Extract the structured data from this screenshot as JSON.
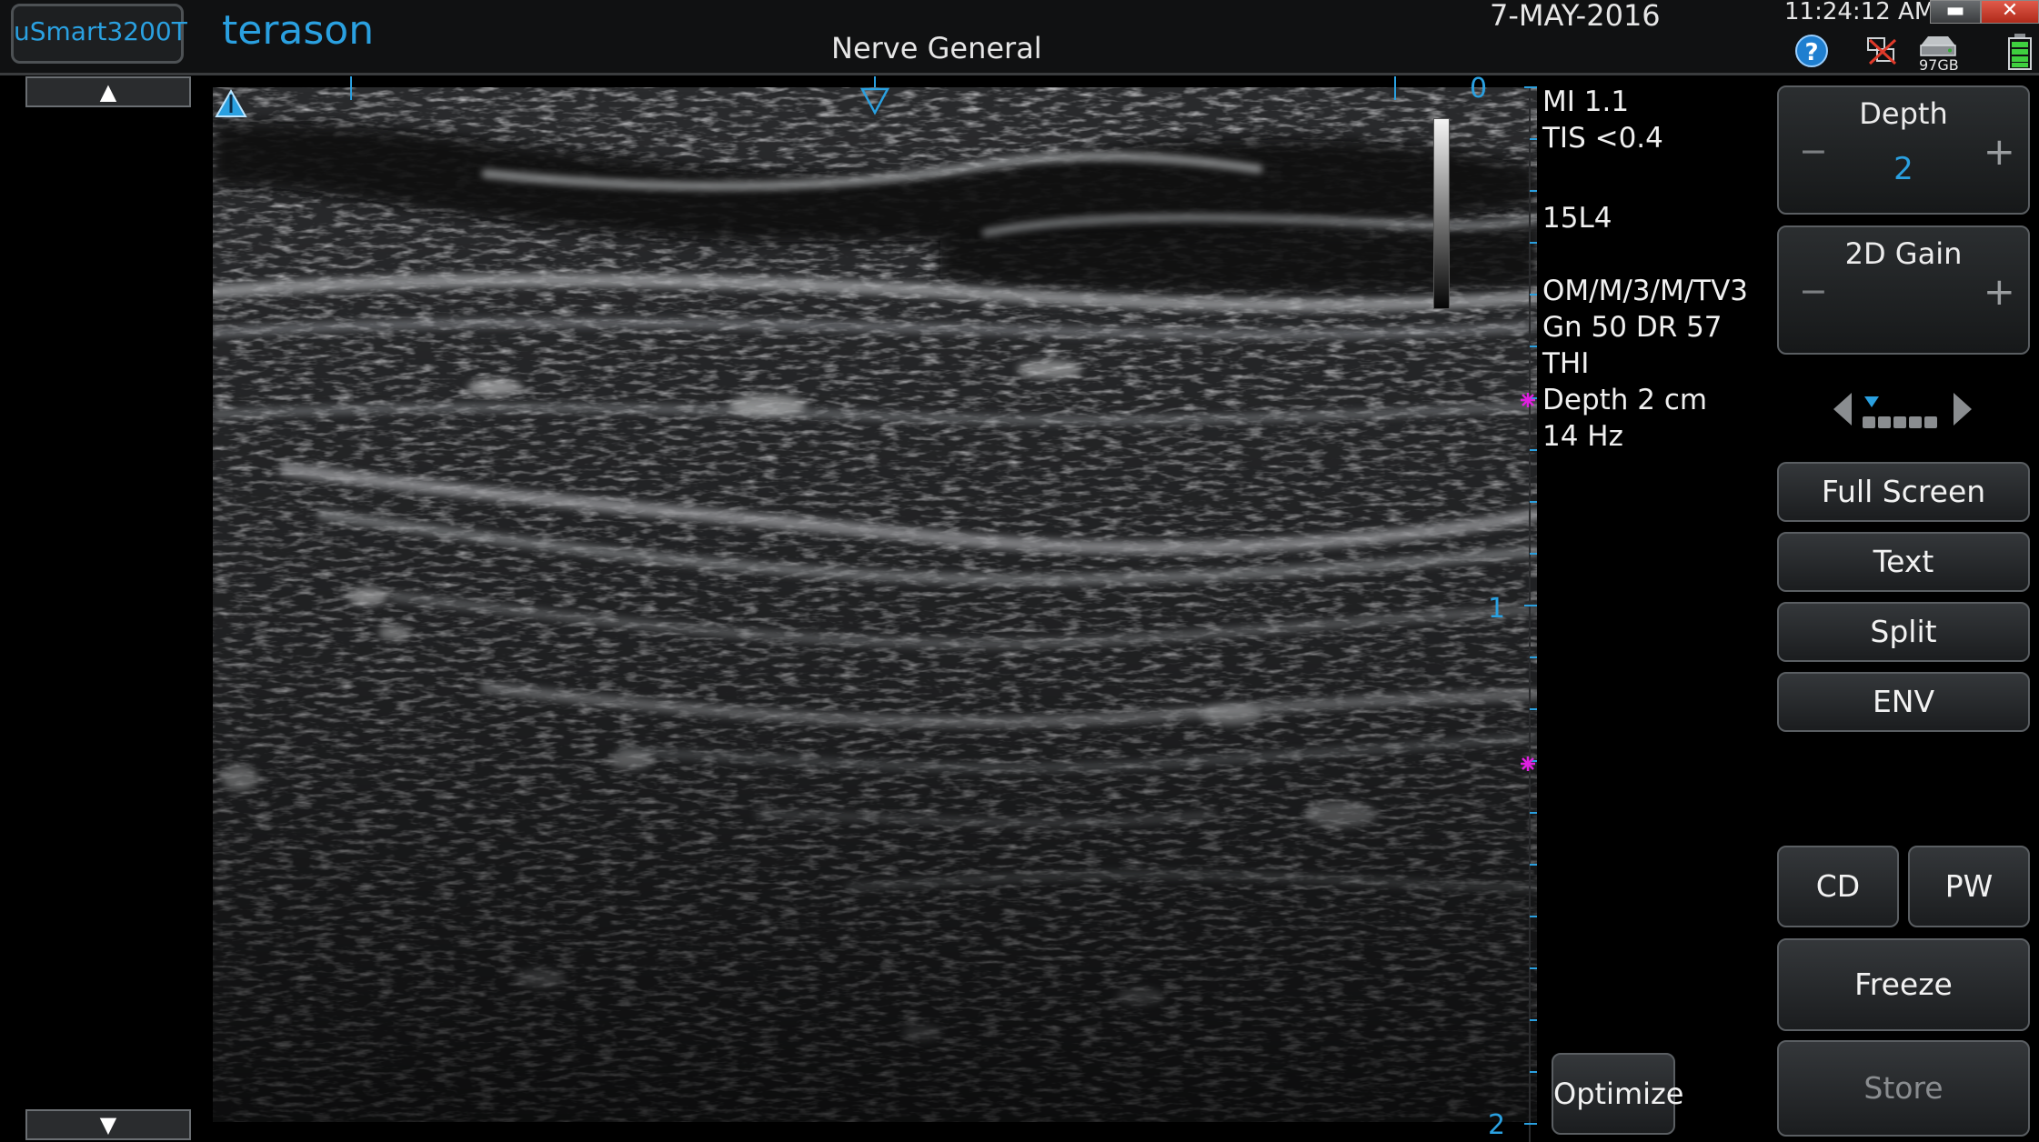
{
  "header": {
    "model": "uSmart3200T",
    "brand": "terason",
    "preset": "Nerve General",
    "date": "7-MAY-2016",
    "time": "11:24:12 AM",
    "storage": "97GB",
    "help": "?"
  },
  "window_controls": {
    "minimize": "▬",
    "close": "✕"
  },
  "scroll": {
    "up": "▲",
    "down": "▼"
  },
  "depth_scale": {
    "labels": [
      "0",
      "1",
      "2"
    ]
  },
  "params": {
    "mi": "MI  1.1",
    "tis": "TIS <0.4",
    "probe": "15L4",
    "om": "OM/M/3/M/TV3",
    "gain": "Gn 50  DR 57",
    "thi": "THI",
    "depth": "Depth 2 cm",
    "rate": "14 Hz"
  },
  "controls": {
    "depth": {
      "title": "Depth",
      "value": "2",
      "minus": "−",
      "plus": "+"
    },
    "gain2d": {
      "title": "2D Gain",
      "minus": "−",
      "plus": "+"
    },
    "page": {
      "count": 5,
      "current": 1
    },
    "full_screen": "Full Screen",
    "text": "Text",
    "split": "Split",
    "env": "ENV",
    "cd": "CD",
    "pw": "PW",
    "freeze": "Freeze",
    "store": "Store",
    "optimize": "Optimize"
  },
  "colors": {
    "accent": "#2aa0e0",
    "marker": "#e020e0",
    "background": "#000000"
  }
}
